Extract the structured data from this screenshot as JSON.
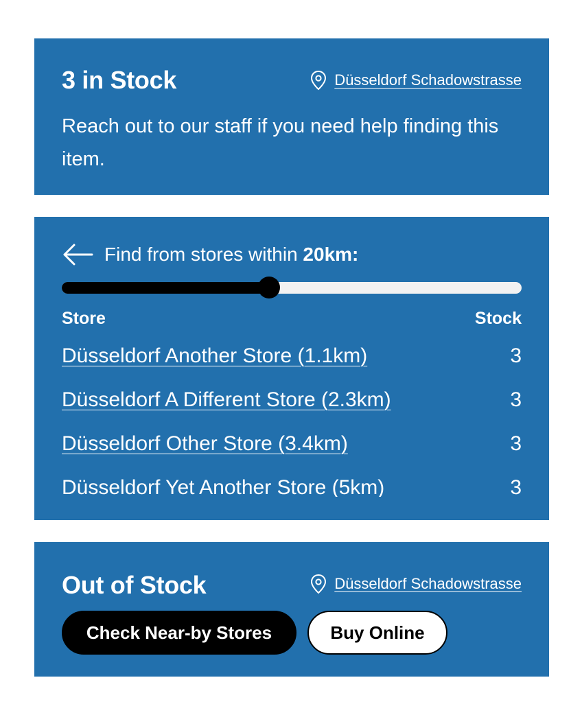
{
  "in_stock_panel": {
    "title": "3 in Stock",
    "location_icon": "map-pin-icon",
    "location_label": "Düsseldorf Schadowstrasse",
    "description": "Reach out to our staff if you need help finding this item."
  },
  "nearby_panel": {
    "back_icon": "arrow-left-icon",
    "find_label": "Find from stores within",
    "radius": "20km:",
    "slider_level": 0.45,
    "table": {
      "columns": [
        "Store",
        "Stock"
      ],
      "rows": [
        {
          "store": "Düsseldorf Another Store (1.1km)",
          "stock": "3"
        },
        {
          "store": "Düsseldorf A Different Store (2.3km)",
          "stock": "3"
        },
        {
          "store": "Düsseldorf Other Store (3.4km)",
          "stock": "3"
        },
        {
          "store": "Düsseldorf Yet Another Store (5km)",
          "stock": "3"
        }
      ]
    }
  },
  "out_of_stock_panel": {
    "title": "Out of Stock",
    "location_icon": "map-pin-icon",
    "location_label": "Düsseldorf Schadowstrasse",
    "check_button": "Check Near-by Stores",
    "buy_button": "Buy Online"
  },
  "colors": {
    "panel_bg": "#2270ad",
    "text": "#ffffff",
    "primary_button": "#000000",
    "slider_track": "#f2f2f2"
  }
}
